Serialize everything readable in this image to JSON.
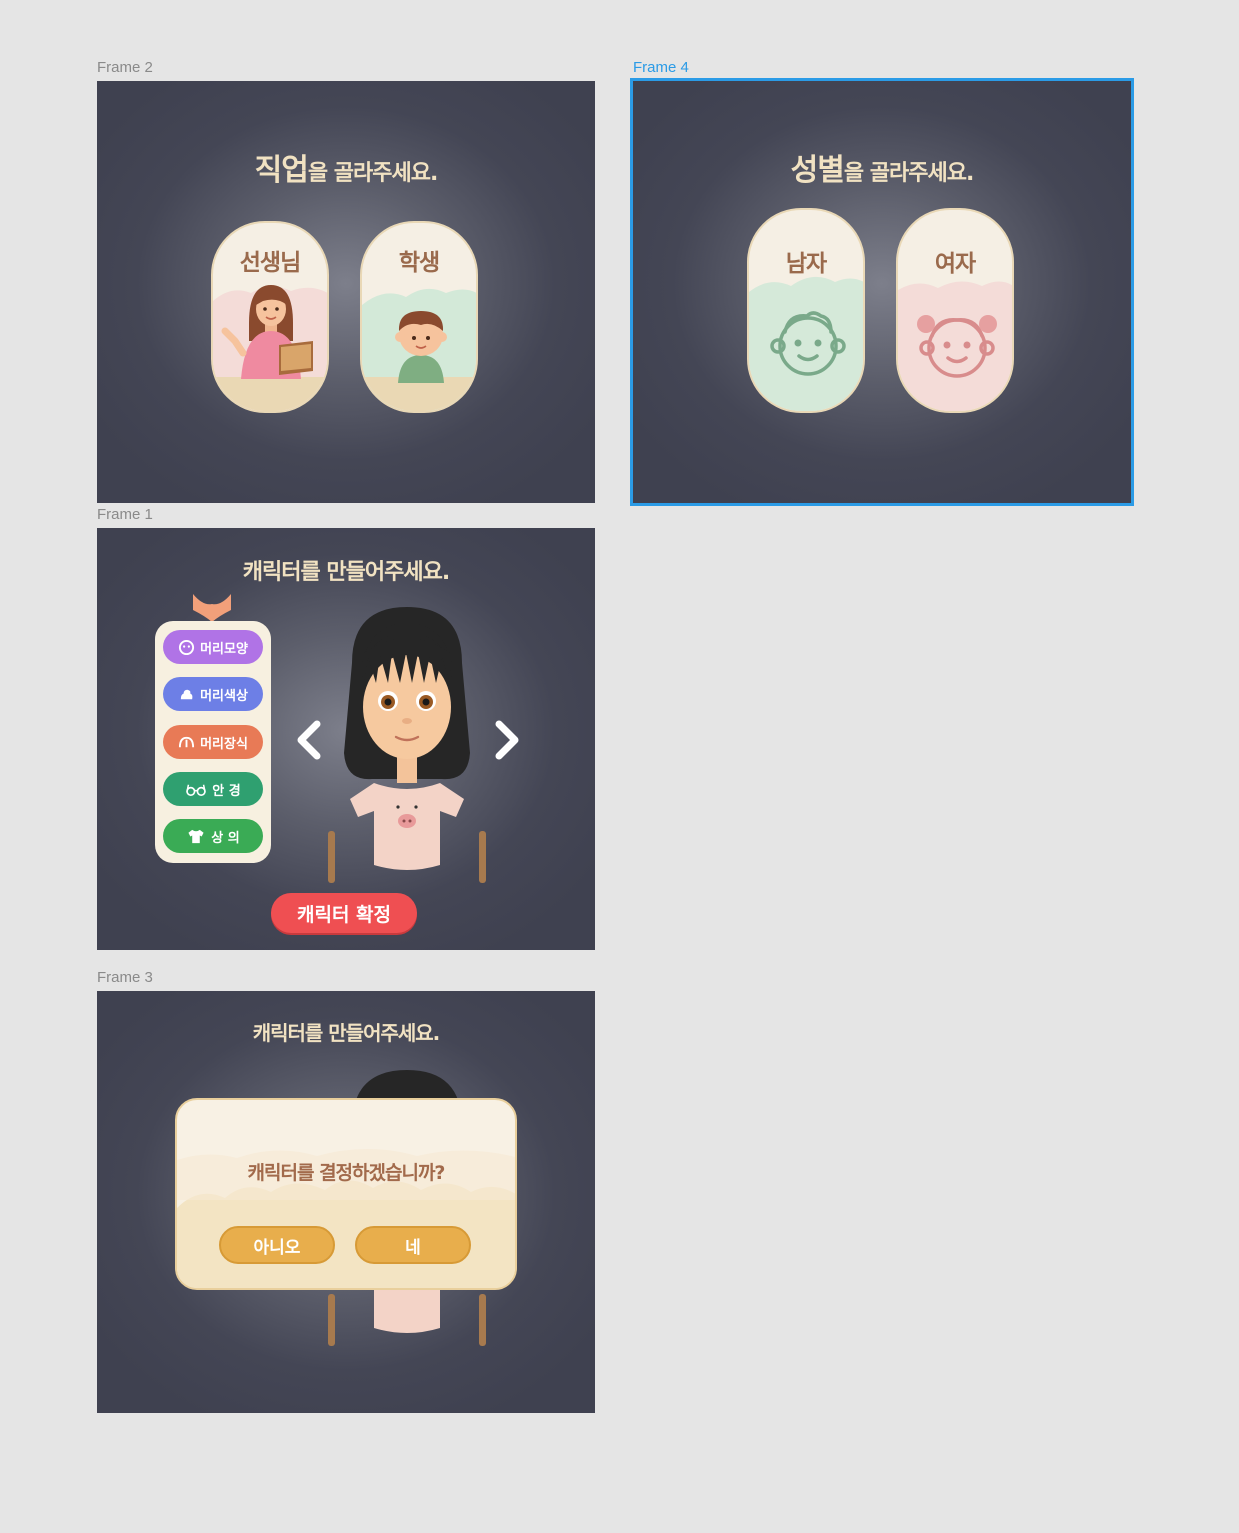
{
  "frames": {
    "frame2": {
      "label": "Frame 2",
      "title_emphasis": "직업",
      "title_rest": "을 골라주세요.",
      "cards": [
        {
          "label": "선생님",
          "icon": "teacher-illustration"
        },
        {
          "label": "학생",
          "icon": "student-illustration"
        }
      ]
    },
    "frame4": {
      "label": "Frame 4",
      "title_emphasis": "성별",
      "title_rest": "을 골라주세요.",
      "cards": [
        {
          "label": "남자",
          "icon": "boy-face-icon"
        },
        {
          "label": "여자",
          "icon": "girl-face-icon"
        }
      ]
    },
    "frame1": {
      "label": "Frame 1",
      "title": "캐릭터를 만들어주세요.",
      "menu": [
        {
          "label": "머리모양",
          "icon": "face-icon",
          "color": "#b073e6"
        },
        {
          "label": "머리색상",
          "icon": "hair-color-icon",
          "color": "#6d7fe6"
        },
        {
          "label": "머리장식",
          "icon": "hair-accessory-icon",
          "color": "#e87a56"
        },
        {
          "label": "안 경",
          "icon": "glasses-icon",
          "color": "#2fa070"
        },
        {
          "label": "상 의",
          "icon": "shirt-icon",
          "color": "#3aab55"
        }
      ],
      "confirm_label": "캐릭터 확정"
    },
    "frame3": {
      "label": "Frame 3",
      "title": "캐릭터를 만들어주세요.",
      "dialog_message": "캐릭터를 결정하겠습니까?",
      "no_label": "아니오",
      "yes_label": "네"
    }
  },
  "colors": {
    "canvas": "#e5e5e5",
    "frame_bg": "#444655",
    "title": "#f1e2c2",
    "selection": "#2b9be6",
    "confirm": "#ef4f52",
    "dialog_button": "#e8ae4c"
  }
}
